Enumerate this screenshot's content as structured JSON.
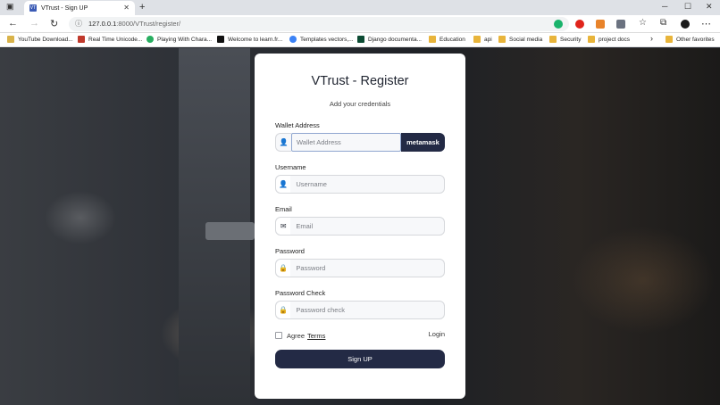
{
  "browser": {
    "tab_title": "VTrust - Sign UP",
    "url_host": "127.0.0.1",
    "url_path": ":8000/VTrust/register/",
    "bookmarks": [
      {
        "label": "YouTube Download..."
      },
      {
        "label": "Real Time Unicode..."
      },
      {
        "label": "Playing With Chara..."
      },
      {
        "label": "Welcome to learn.fr..."
      },
      {
        "label": "Templates vectors,..."
      },
      {
        "label": "Django documenta..."
      },
      {
        "label": "Education"
      },
      {
        "label": "api"
      },
      {
        "label": "Social media"
      },
      {
        "label": "Security"
      },
      {
        "label": "project docs"
      }
    ],
    "other_favorites": "Other favorites"
  },
  "form": {
    "title": "VTrust - Register",
    "subtitle": "Add your credentials",
    "wallet_label": "Wallet Address",
    "wallet_placeholder": "Wallet Address",
    "metamask_label": "metamask",
    "username_label": "Username",
    "username_placeholder": "Username",
    "email_label": "Email",
    "email_placeholder": "Email",
    "password_label": "Password",
    "password_placeholder": "Password",
    "password_check_label": "Password Check",
    "password_check_placeholder": "Password check",
    "agree_label": "Agree",
    "terms_label": "Terms",
    "login_label": "Login",
    "signup_label": "Sign UP"
  },
  "colors": {
    "primary_button": "#232a45"
  }
}
